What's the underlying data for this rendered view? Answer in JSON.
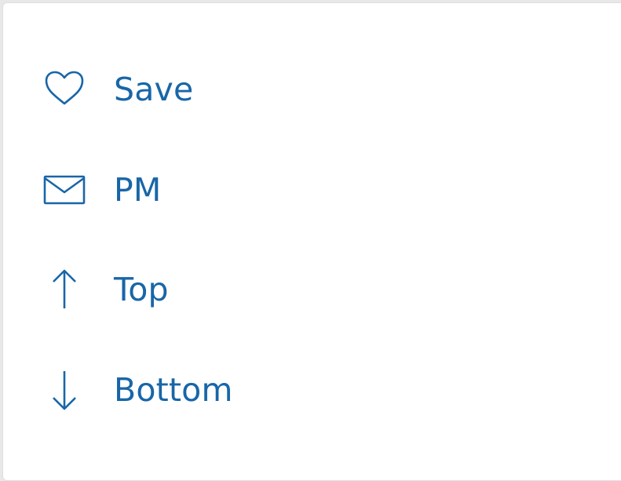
{
  "colors": {
    "accent": "#1866a8",
    "surface": "#ffffff",
    "border": "#dedede"
  },
  "menu": {
    "items": [
      {
        "label": "Save",
        "icon": "heart-outline-icon"
      },
      {
        "label": "PM",
        "icon": "envelope-icon"
      },
      {
        "label": "Top",
        "icon": "arrow-up-icon"
      },
      {
        "label": "Bottom",
        "icon": "arrow-down-icon"
      }
    ]
  }
}
